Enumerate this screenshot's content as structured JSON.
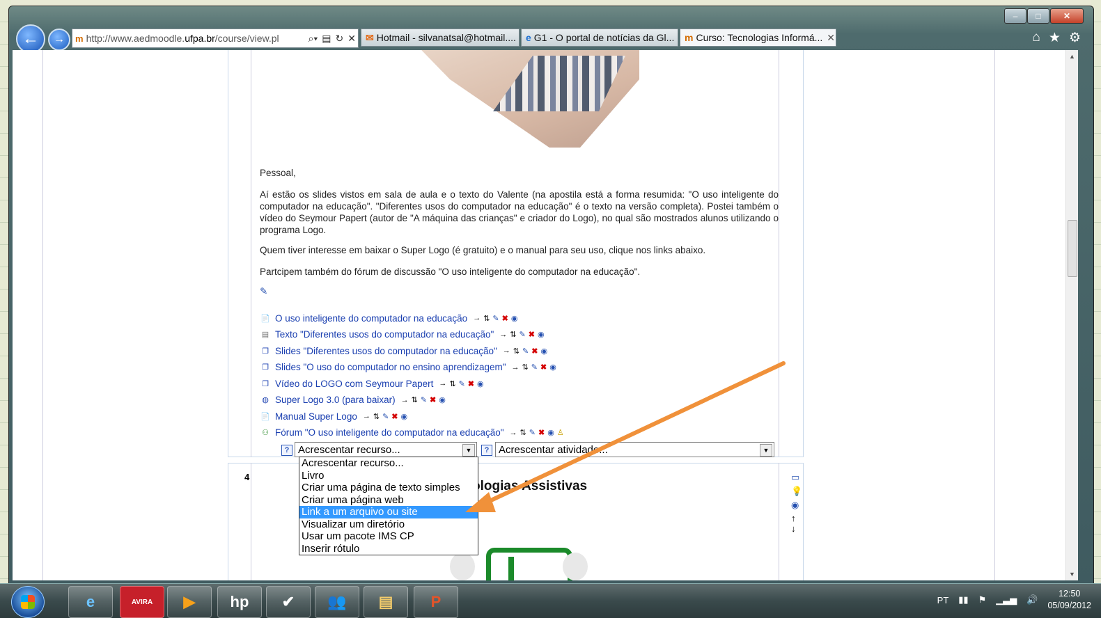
{
  "browser": {
    "window_controls": {
      "minimize": "–",
      "maximize": "□",
      "close": "✕"
    },
    "address_url_prefix": "http://www.aedmoodle.",
    "address_url_domain": "ufpa.br",
    "address_url_suffix": "/course/view.pl",
    "favicon_text": "m",
    "tabs": [
      {
        "label": "Hotmail - silvanatsal@hotmail...."
      },
      {
        "label": "G1 - O portal de notícias da Gl..."
      },
      {
        "label": "Curso: Tecnologias Informá...",
        "close": "✕"
      }
    ]
  },
  "post": {
    "greeting": "Pessoal,",
    "p1": "Aí estão os slides vistos em sala de aula e o texto do Valente (na apostila está a forma resumida: \"O uso inteligente do computador na educação\". \"Diferentes usos do computador na educação\" é o texto na versão completa). Postei também o vídeo do Seymour Papert (autor de \"A máquina das crianças\" e criador do Logo), no qual são mostrados alunos utilizando o programa Logo.",
    "p2": "Quem tiver interesse em baixar o Super Logo (é gratuito) e o manual para seu uso, clique nos links abaixo.",
    "p3": "Partcipem também do fórum de discussão \"O uso inteligente do computador na educação\"."
  },
  "resources": [
    {
      "icon": "pdf-icon",
      "label": "O uso inteligente do computador na educação"
    },
    {
      "icon": "text-file-icon",
      "label": "Texto \"Diferentes usos do computador na educação\""
    },
    {
      "icon": "window-icon",
      "label": "Slides \"Diferentes usos do computador na educação\""
    },
    {
      "icon": "window-icon",
      "label": "Slides \"O uso do computador no ensino aprendizagem\""
    },
    {
      "icon": "window-icon",
      "label": "Vídeo do LOGO com Seymour Papert"
    },
    {
      "icon": "globe-icon",
      "label": "Super Logo 3.0 (para baixar)"
    },
    {
      "icon": "pdf-icon",
      "label": "Manual Super Logo"
    },
    {
      "icon": "forum-icon",
      "label": "Fórum \"O uso inteligente do computador na educação\""
    }
  ],
  "controls": {
    "add_resource": "Acrescentar recurso...",
    "add_activity": "Acrescentar atividade...",
    "help": "?"
  },
  "dropdown_options": [
    "Acrescentar recurso...",
    "Livro",
    "Criar uma página de texto simples",
    "Criar uma página web",
    "Link a um arquivo ou site",
    "Visualizar um diretório",
    "Usar um pacote IMS CP",
    "Inserir rótulo"
  ],
  "dropdown_highlight_index": 4,
  "section4": {
    "number": "4",
    "title_visible": "ologias Assistivas"
  },
  "taskbar": {
    "language": "PT",
    "time": "12:50",
    "date": "05/09/2012",
    "apps": [
      "ie-icon",
      "avira-icon",
      "media-player-icon",
      "hp-icon",
      "check-icon",
      "users-icon",
      "folder-icon",
      "powerpoint-icon"
    ],
    "avira_label": "AVIRA"
  },
  "colors": {
    "link": "#1a3fb0",
    "highlight": "#3399ff",
    "arrow": "#f0913a"
  }
}
